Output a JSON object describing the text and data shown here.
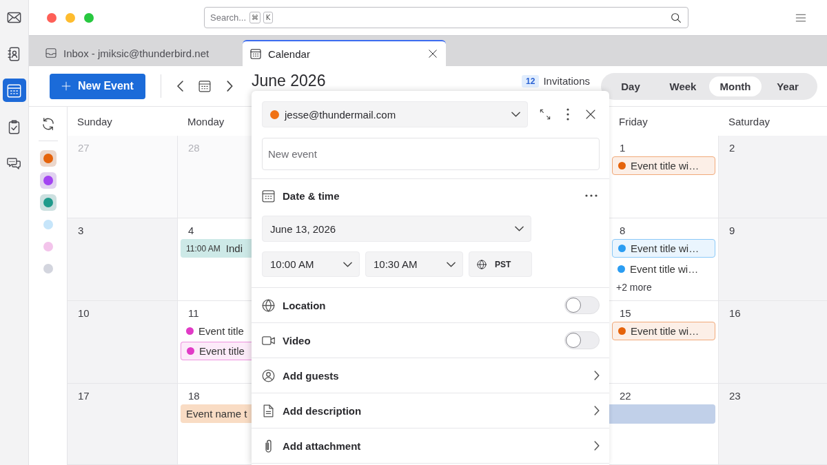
{
  "rail": [
    {
      "kind": "mail",
      "selected": false
    },
    {
      "kind": "contacts",
      "selected": false
    },
    {
      "kind": "calendar",
      "selected": true
    },
    {
      "kind": "tasks",
      "selected": false
    },
    {
      "kind": "chat",
      "selected": false
    }
  ],
  "search": {
    "placeholder": "Search...",
    "shortcut": [
      "⌘",
      "K"
    ]
  },
  "tabs": [
    {
      "kind": "mail",
      "title": "Inbox - jmiksic@thunderbird.net",
      "selected": false
    },
    {
      "kind": "calendar",
      "title": "Calendar",
      "selected": true
    }
  ],
  "toolbar": {
    "new_event": "New Event",
    "title": "June 2026",
    "invitations": {
      "count": "12",
      "label": "Invitations"
    },
    "views": [
      {
        "label": "Day",
        "selected": false
      },
      {
        "label": "Week",
        "selected": false
      },
      {
        "label": "Month",
        "selected": true
      },
      {
        "label": "Year",
        "selected": false
      }
    ]
  },
  "calendars": [
    {
      "color": "#e5630b",
      "enabled": true
    },
    {
      "color": "#a344f2",
      "enabled": true
    },
    {
      "color": "#1f9a8b",
      "enabled": true
    },
    {
      "color": "#c6e5fa",
      "enabled": false
    },
    {
      "color": "#f3c4eb",
      "enabled": false
    },
    {
      "color": "#d3d5de",
      "enabled": false
    }
  ],
  "month_grid": {
    "weekdays": {
      "sunday": "Sunday",
      "monday": "Monday",
      "friday": "Friday",
      "saturday": "Saturday"
    },
    "weeks": [
      {
        "sunday": {
          "day": "27",
          "kind": "other-month"
        },
        "monday": {
          "day": "28",
          "kind": "other-month"
        },
        "friday": {
          "day": "1",
          "kind": "weekday",
          "events": [
            {
              "kind": "chip",
              "color": "#e5630b",
              "title": "Event title wi…"
            }
          ]
        },
        "saturday": {
          "day": "2",
          "kind": "weekend"
        }
      },
      {
        "sunday": {
          "day": "3",
          "kind": "weekend"
        },
        "monday": {
          "day": "4",
          "kind": "weekday",
          "events": [
            {
              "kind": "timed",
              "color": "#cde9e7",
              "time": "11:00 AM",
              "title": "Indi"
            }
          ]
        },
        "friday": {
          "day": "8",
          "kind": "weekday",
          "events": [
            {
              "kind": "chip",
              "color": "#2b9df2",
              "title": "Event title wi…"
            },
            {
              "kind": "dot",
              "color": "#2b9df2",
              "title": "Event title wi…"
            }
          ],
          "more": "+2 more"
        },
        "saturday": {
          "day": "9",
          "kind": "weekend"
        }
      },
      {
        "sunday": {
          "day": "10",
          "kind": "weekend"
        },
        "monday": {
          "day": "11",
          "kind": "weekday",
          "events": [
            {
              "kind": "dot",
              "color": "#e13bc6",
              "title": "Event title"
            },
            {
              "kind": "chip",
              "color": "#e13bc6",
              "title": "Event title"
            }
          ]
        },
        "friday": {
          "day": "15",
          "kind": "weekday",
          "events": [
            {
              "kind": "chip",
              "color": "#e5630b",
              "title": "Event title wi…"
            }
          ]
        },
        "saturday": {
          "day": "16",
          "kind": "weekend"
        }
      },
      {
        "sunday": {
          "day": "17",
          "kind": "weekend"
        },
        "monday": {
          "day": "18",
          "kind": "weekday",
          "events": [
            {
              "kind": "block",
              "color": "#f9dcc4",
              "title": "Event name t"
            }
          ]
        },
        "friday": {
          "day": "22",
          "kind": "weekday",
          "events": [
            {
              "kind": "block",
              "color": "#c1d0e9"
            }
          ]
        },
        "saturday": {
          "day": "23",
          "kind": "weekend"
        }
      }
    ]
  },
  "event_editor": {
    "calendar": {
      "name": "jesse@thundermail.com",
      "color": "#f07216"
    },
    "title": {
      "placeholder": "New event"
    },
    "date_time": {
      "heading": "Date & time",
      "date": "June 13, 2026",
      "start_time": "10:00 AM",
      "end_time": "10:30 AM",
      "timezone": "PST"
    },
    "options": [
      {
        "kind": "toggle",
        "label": "Location",
        "on": false
      },
      {
        "kind": "toggle",
        "label": "Video",
        "on": false
      },
      {
        "kind": "link",
        "label": "Add guests"
      },
      {
        "kind": "link",
        "label": "Add description"
      },
      {
        "kind": "link",
        "label": "Add attachment"
      }
    ]
  }
}
